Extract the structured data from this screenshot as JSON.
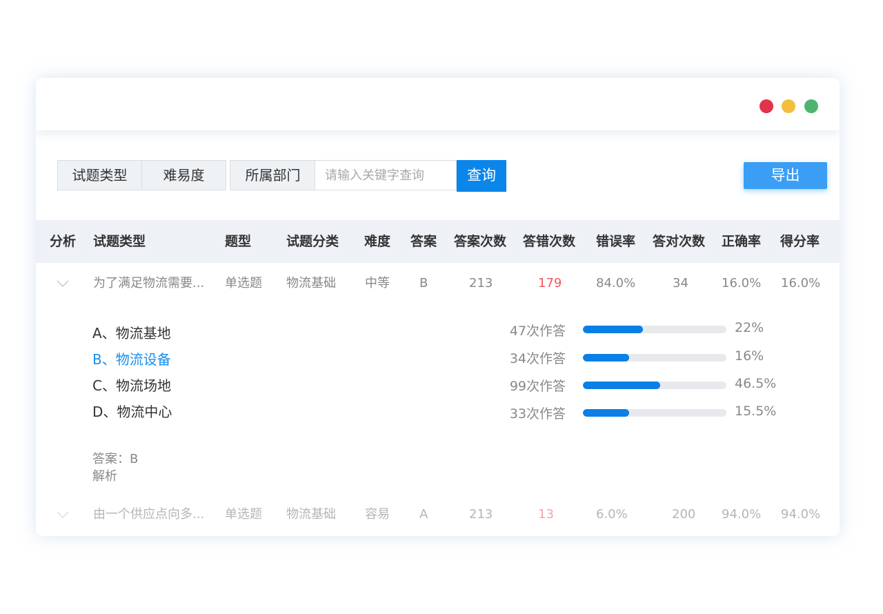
{
  "window": {
    "controls": {
      "red": "#e2334a",
      "yellow": "#f3be3c",
      "green": "#4cb46e"
    }
  },
  "filters": {
    "type_label": "试题类型",
    "difficulty_label": "难易度",
    "department_label": "所属部门",
    "search_placeholder": "请输入关键字查询",
    "search_value": "",
    "query_button": "查询",
    "export_button": "导出"
  },
  "table": {
    "headers": [
      "分析",
      "试题类型",
      "题型",
      "试题分类",
      "难度",
      "答案",
      "答案次数",
      "答错次数",
      "错误率",
      "答对次数",
      "正确率",
      "得分率"
    ],
    "rows": [
      {
        "question": "为了满足物流需要...",
        "kind": "单选题",
        "category": "物流基础",
        "difficulty": "中等",
        "answer": "B",
        "answer_count": "213",
        "wrong_count": "179",
        "error_rate": "84.0%",
        "correct_count": "34",
        "correct_rate": "16.0%",
        "score_rate": "16.0%",
        "expanded": true
      },
      {
        "question": "由一个供应点向多...",
        "kind": "单选题",
        "category": "物流基础",
        "difficulty": "容易",
        "answer": "A",
        "answer_count": "213",
        "wrong_count": "13",
        "error_rate": "6.0%",
        "correct_count": "200",
        "correct_rate": "94.0%",
        "score_rate": "94.0%",
        "expanded": false
      }
    ]
  },
  "detail": {
    "options": [
      {
        "label": "A、物流基地",
        "count": "47次作答",
        "percent_label": "22%",
        "fill": 0.42,
        "correct": false
      },
      {
        "label": "B、物流设备",
        "count": "34次作答",
        "percent_label": "16%",
        "fill": 0.32,
        "correct": true
      },
      {
        "label": "C、物流场地",
        "count": "99次作答",
        "percent_label": "46.5%",
        "fill": 0.54,
        "correct": false
      },
      {
        "label": "D、物流中心",
        "count": "33次作答",
        "percent_label": "15.5%",
        "fill": 0.32,
        "correct": false
      }
    ],
    "answer_text": "答案：B",
    "analysis_label": "解析"
  },
  "colors": {
    "primary": "#0a86ea",
    "export": "#3a9ef4",
    "correct_option": "#1a8de9",
    "error": "#f0575c"
  }
}
